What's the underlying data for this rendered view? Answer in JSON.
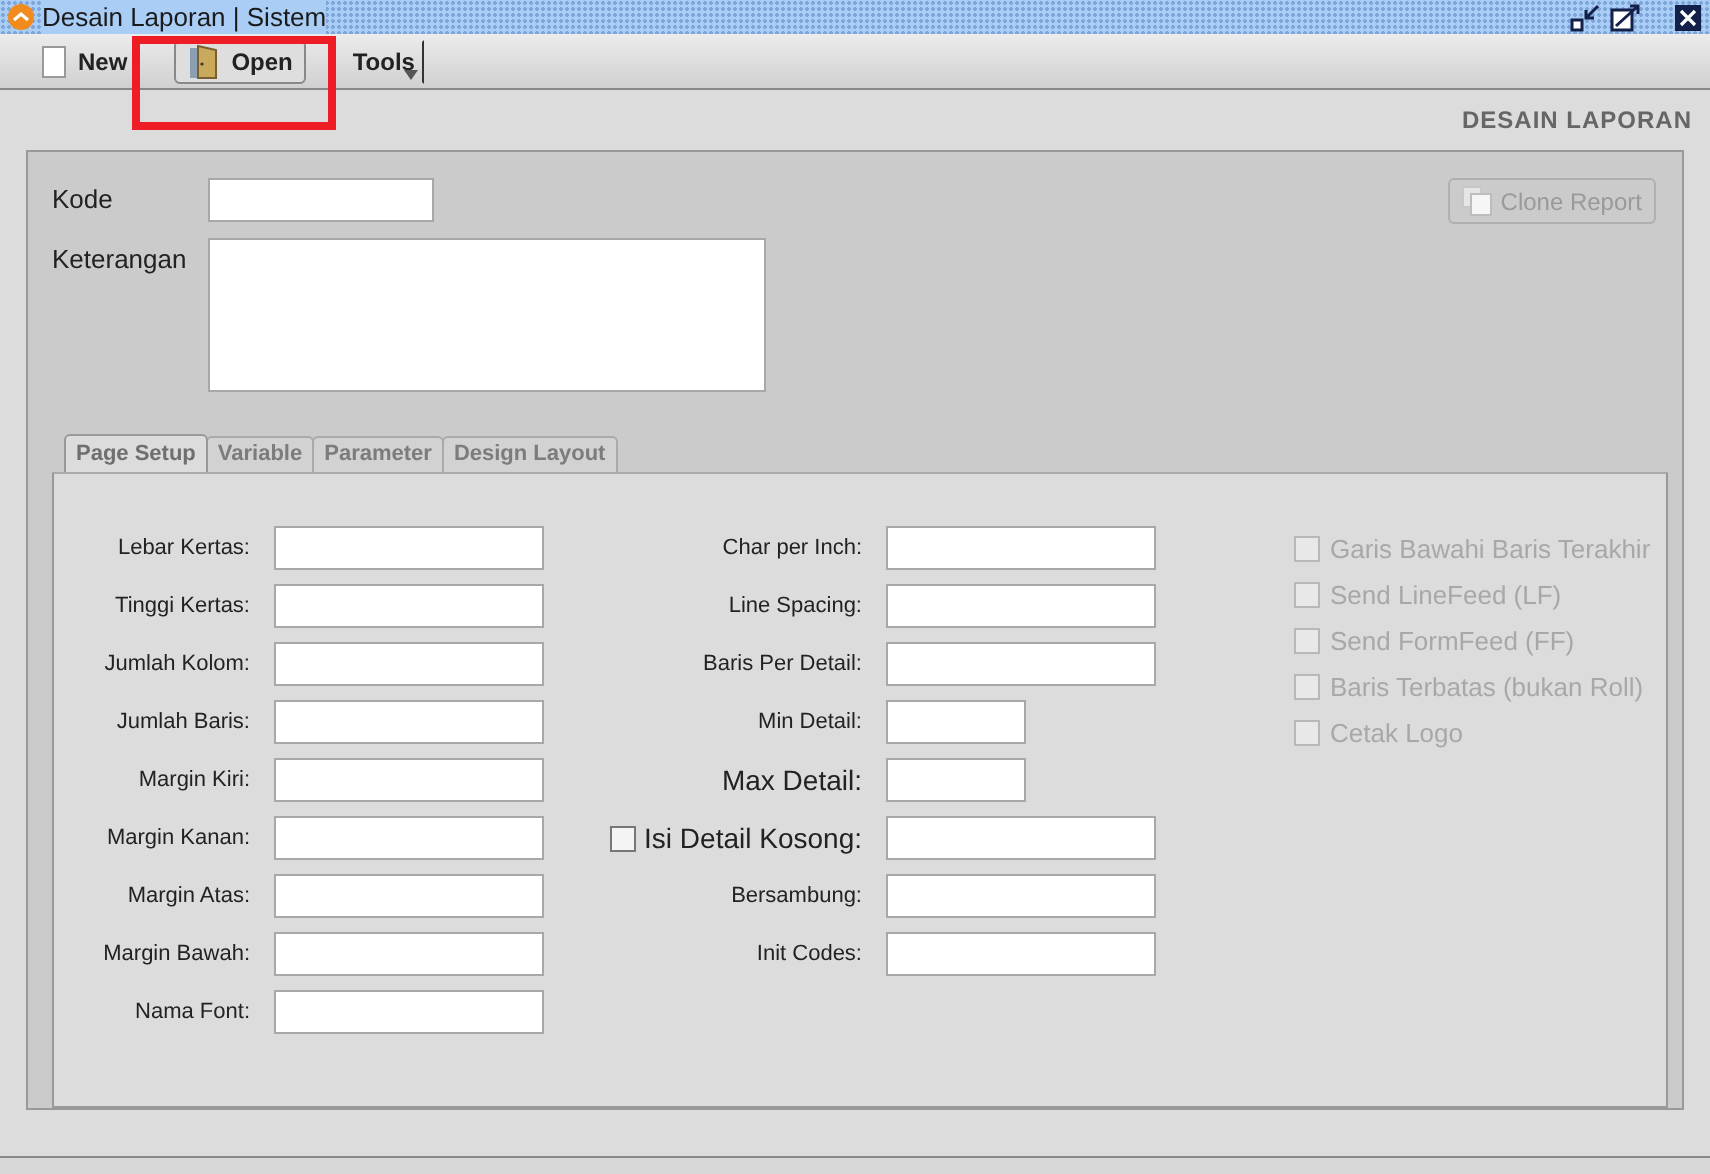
{
  "window": {
    "title": "Desain Laporan | Sistem"
  },
  "toolbar": [
    {
      "kind": "doc",
      "label": "New",
      "pressed": false
    },
    {
      "kind": "door",
      "label": "Open",
      "pressed": true
    },
    {
      "kind": "menu",
      "label": "Tools",
      "pressed": false
    }
  ],
  "header": "DESAIN LAPORAN",
  "form": {
    "fields": [
      {
        "label": "Kode",
        "kind": "line"
      },
      {
        "label": "Keterangan",
        "kind": "area"
      }
    ],
    "clone_button": {
      "label": "Clone Report",
      "disabled": true
    }
  },
  "tabs": [
    {
      "label": "Page Setup",
      "selected": true,
      "disabled": false
    },
    {
      "label": "Variable",
      "selected": false,
      "disabled": true
    },
    {
      "label": "Parameter",
      "selected": false,
      "disabled": true
    },
    {
      "label": "Design Layout",
      "selected": false,
      "disabled": true
    }
  ],
  "left_fields": [
    {
      "label": "Lebar Kertas:"
    },
    {
      "label": "Tinggi Kertas:"
    },
    {
      "label": "Jumlah Kolom:"
    },
    {
      "label": "Jumlah Baris:"
    },
    {
      "label": "Margin Kiri:"
    },
    {
      "label": "Margin Kanan:"
    },
    {
      "label": "Margin Atas:"
    },
    {
      "label": "Margin Bawah:"
    },
    {
      "label": "Nama Font:"
    }
  ],
  "right_fields": [
    {
      "label": "Char per Inch:",
      "kind": "long",
      "large": false
    },
    {
      "label": "Line Spacing:",
      "kind": "long",
      "large": false
    },
    {
      "label": "Baris Per Detail:",
      "kind": "long",
      "large": false
    },
    {
      "label": "Min Detail:",
      "kind": "short",
      "large": false
    },
    {
      "label": "Max Detail:",
      "kind": "short",
      "large": true
    },
    {
      "label": "Isi Detail Kosong:",
      "kind": "check_long",
      "large": true,
      "checked": false
    },
    {
      "label": "Bersambung:",
      "kind": "long",
      "large": false
    },
    {
      "label": "Init Codes:",
      "kind": "long",
      "large": false
    }
  ],
  "options": [
    {
      "label": "Garis Bawahi Baris Terakhir",
      "checked": false,
      "disabled": true
    },
    {
      "label": "Send LineFeed (LF)",
      "checked": false,
      "disabled": true
    },
    {
      "label": "Send FormFeed (FF)",
      "checked": false,
      "disabled": true
    },
    {
      "label": "Baris Terbatas (bukan Roll)",
      "checked": false,
      "disabled": true
    },
    {
      "label": "Cetak Logo",
      "checked": false,
      "disabled": true
    }
  ]
}
